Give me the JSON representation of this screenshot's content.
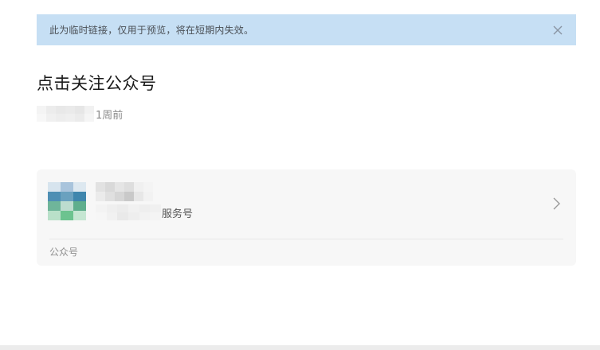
{
  "notice": {
    "text": "此为临时链接，仅用于预览，将在短期内失效。",
    "close_icon": "close-icon",
    "bg_color": "#c6dff4"
  },
  "article": {
    "title": "点击关注公众号",
    "time_suffix": "1周前"
  },
  "card": {
    "account_type_suffix": "服务号",
    "footer_label": "公众号",
    "arrow_icon": "chevron-right-icon",
    "bg_color": "#f7f7f7"
  }
}
